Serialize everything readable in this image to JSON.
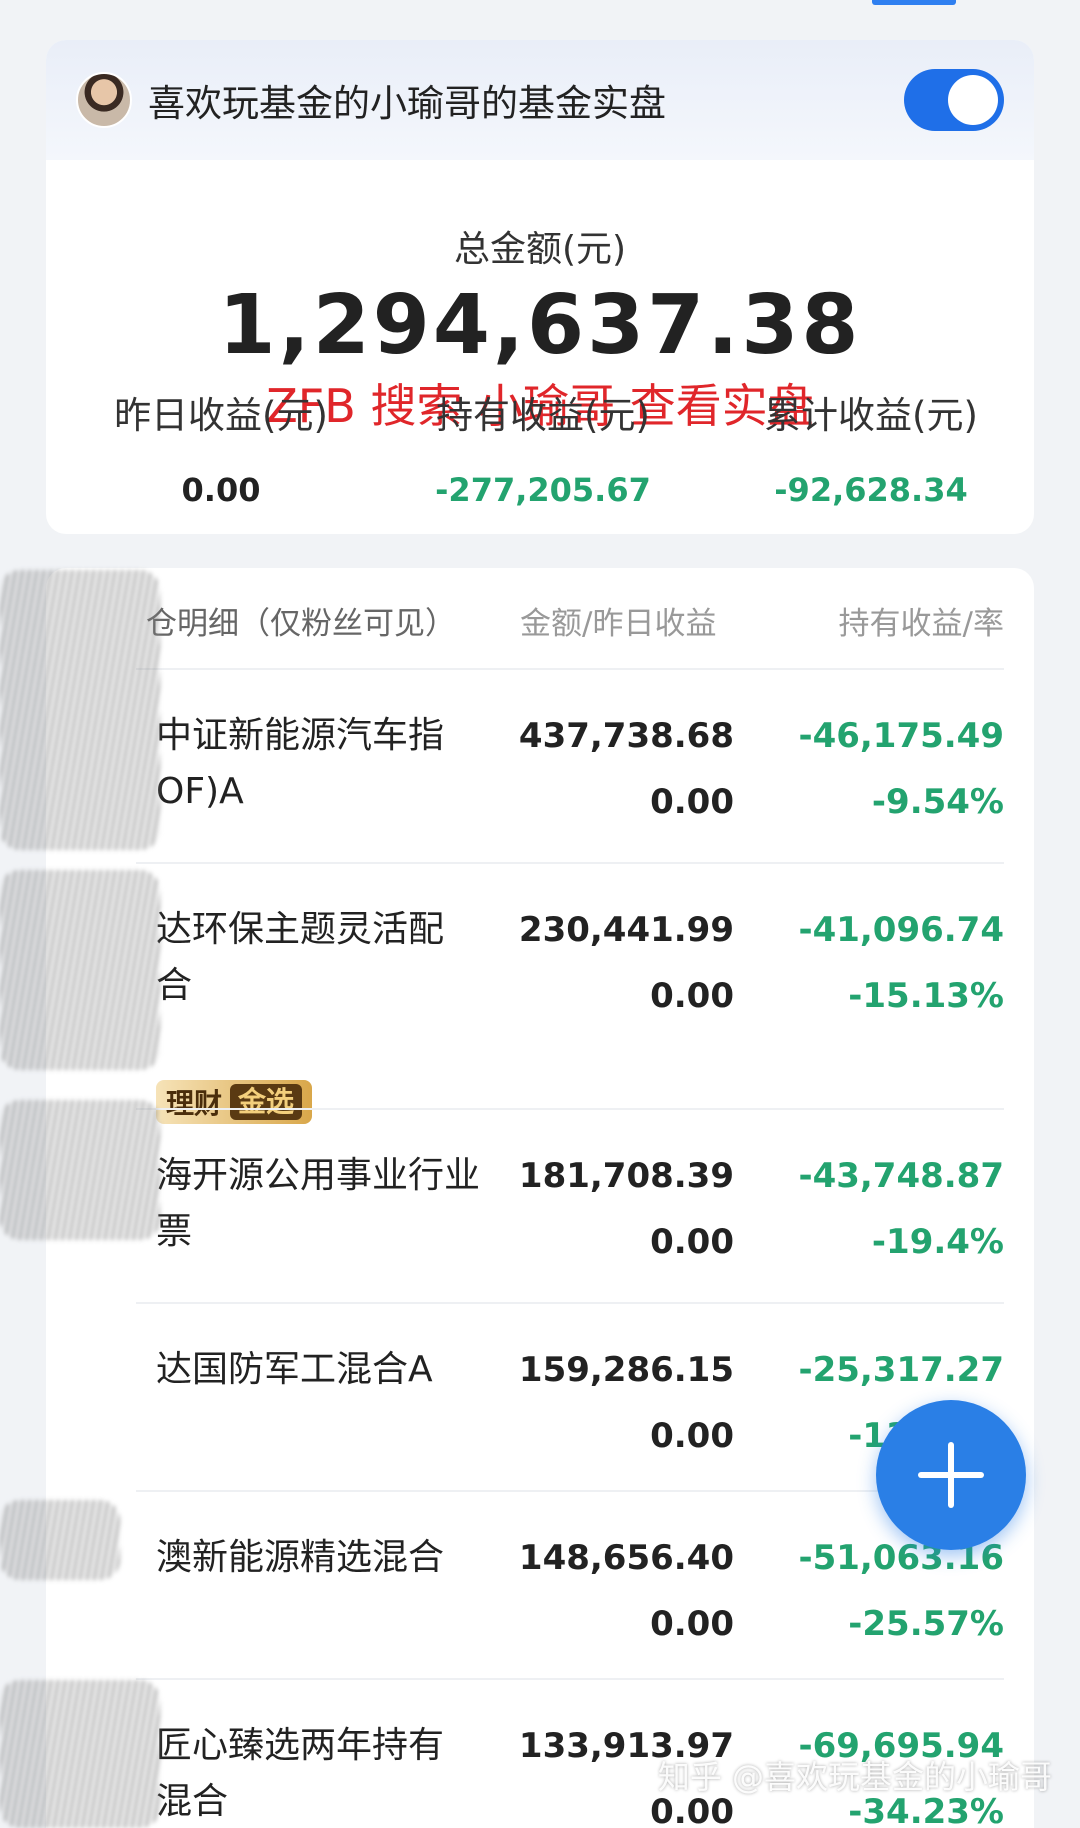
{
  "account": {
    "name": "喜欢玩基金的小瑜哥的基金实盘",
    "toggle_on": true
  },
  "summary": {
    "total_label": "总金额(元)",
    "total_amount": "1,294,637.38",
    "promo": "ZFB 搜索 小瑜哥 查看实盘",
    "yesterday_label": "昨日收益(元)",
    "yesterday_value": "0.00",
    "holding_label": "持有收益(元)",
    "holding_value": "-277,205.67",
    "cumulative_label": "累计收益(元)",
    "cumulative_value": "-92,628.34"
  },
  "holdings": {
    "header": {
      "name_col": "仓明细（仅粉丝可见）",
      "amount_col": "金额/昨日收益",
      "profit_col": "持有收益/率"
    },
    "rows": [
      {
        "name": "中证新能源汽车指\nOF)A",
        "amount": "437,738.68",
        "yesterday": "0.00",
        "profit": "-46,175.49",
        "rate": "-9.54%"
      },
      {
        "name": "达环保主题灵活配\n合",
        "amount": "230,441.99",
        "yesterday": "0.00",
        "profit": "-41,096.74",
        "rate": "-15.13%",
        "badge": "理财",
        "badge_gold": "金选"
      },
      {
        "name": "海开源公用事业行业\n票",
        "amount": "181,708.39",
        "yesterday": "0.00",
        "profit": "-43,748.87",
        "rate": "-19.4%"
      },
      {
        "name": "达国防军工混合A",
        "amount": "159,286.15",
        "yesterday": "0.00",
        "profit": "-25,317.27",
        "rate": "-13.71%"
      },
      {
        "name": "澳新能源精选混合",
        "amount": "148,656.40",
        "yesterday": "0.00",
        "profit": "-51,063.16",
        "rate": "-25.57%"
      },
      {
        "name": "匠心臻选两年持有\n混合",
        "amount": "133,913.97",
        "yesterday": "0.00",
        "profit": "-69,695.94",
        "rate": "-34.23%"
      }
    ]
  },
  "watermark": "知乎 @喜欢玩基金的小瑜哥",
  "colors": {
    "negative": "#23a36f",
    "accent": "#2a7fe6",
    "promo": "#e0262a"
  }
}
